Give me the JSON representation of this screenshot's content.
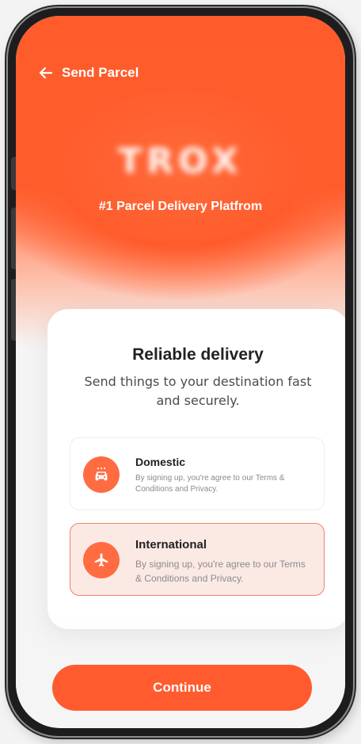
{
  "header": {
    "title": "Send Parcel",
    "back_icon": "arrow-left-icon"
  },
  "hero": {
    "logo_text": "TROX",
    "tagline": "#1 Parcel Delivery Platfrom"
  },
  "card": {
    "title": "Reliable delivery",
    "subtitle": "Send things to your destination fast and securely."
  },
  "options": [
    {
      "title": "Domestic",
      "description": "By signing up, you're agree to our Terms & Conditions and Privacy.",
      "icon": "car-icon",
      "selected": false
    },
    {
      "title": "International",
      "description": "By signing up, you're agree to our Terms & Conditions and Privacy.",
      "icon": "airplane-icon",
      "selected": true
    }
  ],
  "actions": {
    "continue_label": "Continue"
  },
  "colors": {
    "accent": "#ff5b2e",
    "selected_bg": "#fbe9e4",
    "selected_border": "#f18367"
  }
}
